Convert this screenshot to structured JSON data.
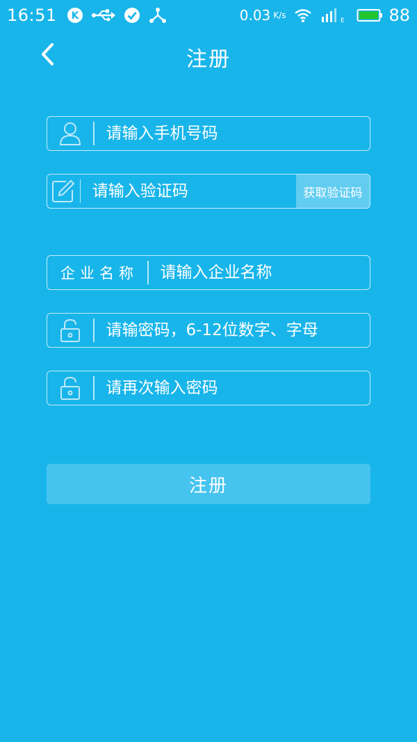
{
  "status_bar": {
    "time": "16:51",
    "net_speed": "0.03",
    "net_speed_unit": "K/s",
    "battery_level": "88",
    "battery_color": "#22c52a",
    "icons": [
      "k-app-icon",
      "usb-icon",
      "check-circle-icon",
      "share-icon",
      "wifi-icon",
      "signal-icon",
      "battery-icon"
    ]
  },
  "header": {
    "title": "注册"
  },
  "form": {
    "phone_placeholder": "请输入手机号码",
    "code_placeholder": "请输入验证码",
    "get_code_label": "获取验证码",
    "company_label": "企业名称",
    "company_placeholder": "请输入企业名称",
    "password_placeholder": "请输密码，6-12位数字、字母",
    "confirm_password_placeholder": "请再次输入密码",
    "submit_label": "注册"
  },
  "colors": {
    "background": "#18b5ea",
    "text": "#ffffff"
  }
}
